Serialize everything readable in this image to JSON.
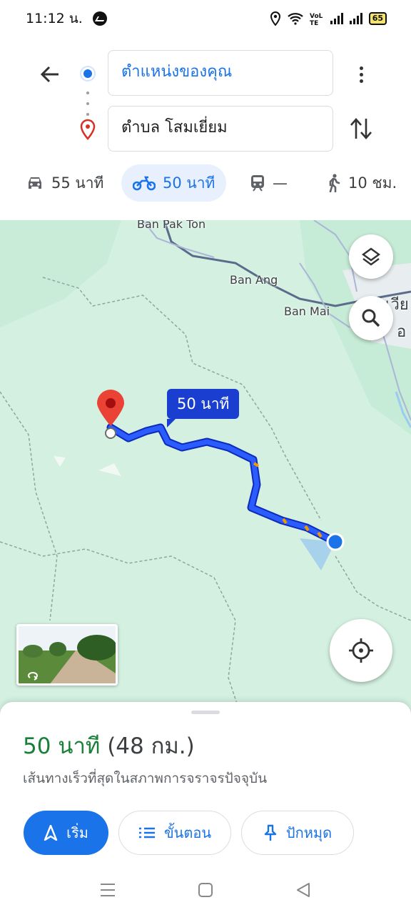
{
  "status_bar": {
    "time": "11:12 น.",
    "battery": "65",
    "icons": [
      "messenger-icon",
      "location-icon",
      "wifi-icon",
      "volte-icon",
      "signal-icon",
      "signal-icon",
      "battery-icon"
    ]
  },
  "directions": {
    "origin": "ตำแหน่งของคุณ",
    "destination": "ตำบล โสมเยี่ยม"
  },
  "modes": [
    {
      "icon": "car-icon",
      "label": "55 นาที",
      "active": false
    },
    {
      "icon": "motorcycle-icon",
      "label": "50 นาที",
      "active": true
    },
    {
      "icon": "transit-icon",
      "label": "—",
      "active": false
    },
    {
      "icon": "walk-icon",
      "label": "10 ชม.",
      "active": false
    }
  ],
  "map": {
    "places": [
      "Ban Pak Ton",
      "Ban Ang",
      "Ban Mai",
      "เวีย",
      "อ"
    ],
    "route_label": "50 นาที",
    "colors": {
      "route": "#1a3fd0",
      "map_bg": "#d3f0e0",
      "accent": "#1a73e8"
    }
  },
  "sheet": {
    "duration": "50 นาที",
    "distance": "(48 กม.)",
    "subtitle": "เส้นทางเร็วที่สุดในสภาพการจราจรปัจจุบัน",
    "start_label": "เริ่ม",
    "steps_label": "ขั้นตอน",
    "pin_label": "ปักหมุด"
  }
}
